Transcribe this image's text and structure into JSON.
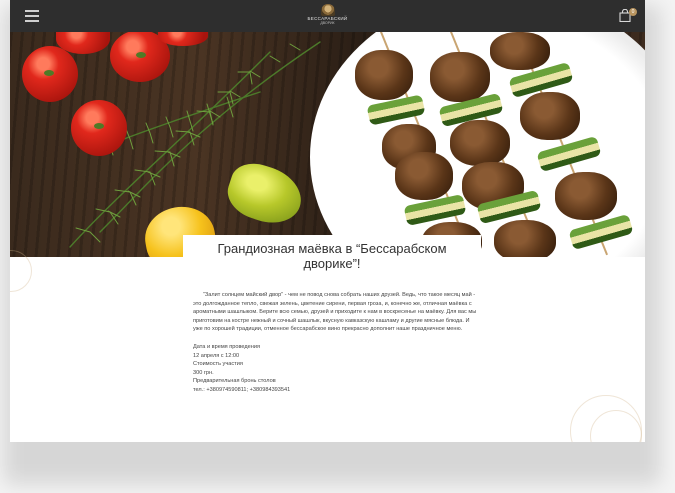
{
  "header": {
    "logo_line1": "БЕССАРАБСКИЙ",
    "logo_line2": "ДВОРИК",
    "cart_count": "0"
  },
  "event": {
    "title": "Грандиозная маёвка в “Бессарабском дворике”!",
    "intro": "“Залит солнцем майский двор” - чем не повод снова собрать наших друзей. Ведь, что такое месяц май - это долгожданное тепло, свежая зелень, цветение сирени, первая гроза, и, конечно же, отличная маёвка с ароматными шашлыком. Берите всю семью, друзей и приходите к нам в воскресенье на маёвку. Для вас мы приготовим на костре нежный и сочный шашлык, вкусную  кавказскую кашламу и другие мясные блюда. И уже по хорошей традиции, отменное бессарабское вино прекрасно дополнит наше праздничное меню.",
    "date_label": "Дата и время проведения",
    "date_value": "12 апреля с 12:00",
    "price_label": "Стоимость участия",
    "price_value": "300 грн.",
    "booking_label": "Предварительная бронь столов",
    "phones": "тел.: +380974590811; +380984393541"
  },
  "icons": {
    "menu": "hamburger-icon",
    "cart": "shopping-bag-icon"
  },
  "colors": {
    "header_bg": "#2e2e2e",
    "accent": "#b99560",
    "text": "#444444"
  }
}
